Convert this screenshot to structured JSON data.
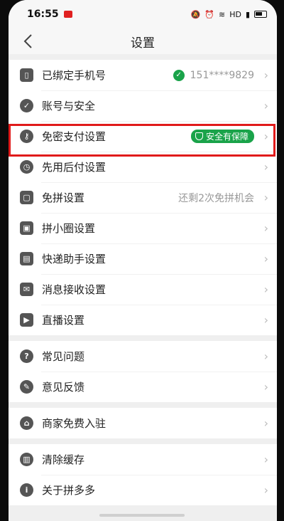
{
  "status_bar": {
    "time": "16:55",
    "network": "HD"
  },
  "nav": {
    "title": "设置"
  },
  "groups": [
    {
      "items": [
        {
          "label": "已绑定手机号",
          "value": "151****9829",
          "icon": "phone-icon"
        },
        {
          "label": "账号与安全",
          "icon": "shield-icon"
        },
        {
          "label": "免密支付设置",
          "badge": "安全有保障",
          "icon": "key-icon"
        },
        {
          "label": "先用后付设置",
          "icon": "clock-icon"
        },
        {
          "label": "免拼设置",
          "value": "还剩2次免拼机会",
          "icon": "ticket-icon"
        },
        {
          "label": "拼小圈设置",
          "icon": "bag-icon"
        },
        {
          "label": "快递助手设置",
          "icon": "parcel-icon"
        },
        {
          "label": "消息接收设置",
          "icon": "mail-icon"
        },
        {
          "label": "直播设置",
          "icon": "camera-icon"
        }
      ]
    },
    {
      "items": [
        {
          "label": "常见问题",
          "icon": "question-icon"
        },
        {
          "label": "意见反馈",
          "icon": "pencil-icon"
        }
      ]
    },
    {
      "items": [
        {
          "label": "商家免费入驻",
          "icon": "store-icon"
        }
      ]
    },
    {
      "items": [
        {
          "label": "清除缓存",
          "icon": "trash-icon"
        },
        {
          "label": "关于拼多多",
          "icon": "info-icon"
        }
      ]
    }
  ],
  "colors": {
    "accent_green": "#1aa34a",
    "highlight_red": "#e01a1a"
  }
}
